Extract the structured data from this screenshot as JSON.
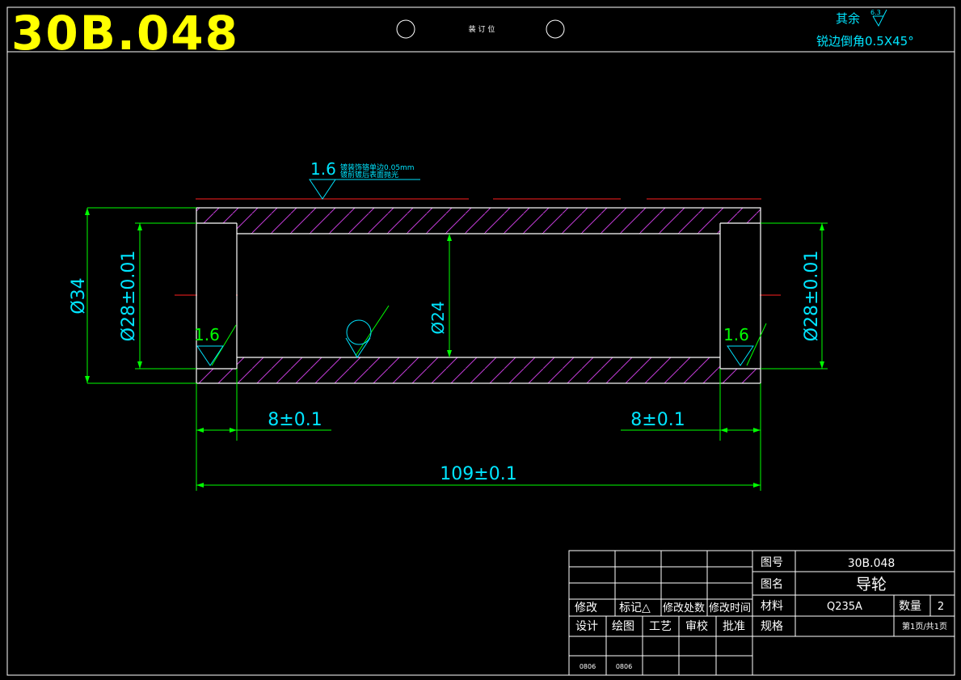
{
  "drawing_number_big": "30B.048",
  "binding_label": "装 订 位",
  "roughness_note": {
    "prefix": "其余",
    "value": "6.3",
    "chamfer": "锐边倒角0.5X45°"
  },
  "surface_finish": {
    "top_value": "1.6",
    "top_note_line1": "镀装饰铬单边0.05mm",
    "top_note_line2": "镀前镀后表面抛光",
    "left_value": "1.6",
    "right_value": "1.6"
  },
  "dimensions": {
    "outer_diameter": "Ø34",
    "left_bore": "Ø28±0.01",
    "right_bore": "Ø28±0.01",
    "inner_diameter": "Ø24",
    "left_counterbore_depth": "8±0.1",
    "right_counterbore_depth": "8±0.1",
    "overall_length": "109±0.1"
  },
  "title_block": {
    "labels": {
      "drawing_no": "图号",
      "drawing_name": "图名",
      "material": "材料",
      "quantity": "数量",
      "spec": "规格",
      "modify": "修改",
      "mark": "标记△",
      "modify_place": "修改处数",
      "modify_time": "修改时间",
      "design": "设计",
      "draft": "绘图",
      "process": "工艺",
      "check": "审校",
      "approve": "批准"
    },
    "drawing_no": "30B.048",
    "drawing_name": "导轮",
    "material": "Q235A",
    "quantity": "2",
    "sheet": "第1页/共1页",
    "date_design": "0806",
    "date_draft": "0806"
  }
}
